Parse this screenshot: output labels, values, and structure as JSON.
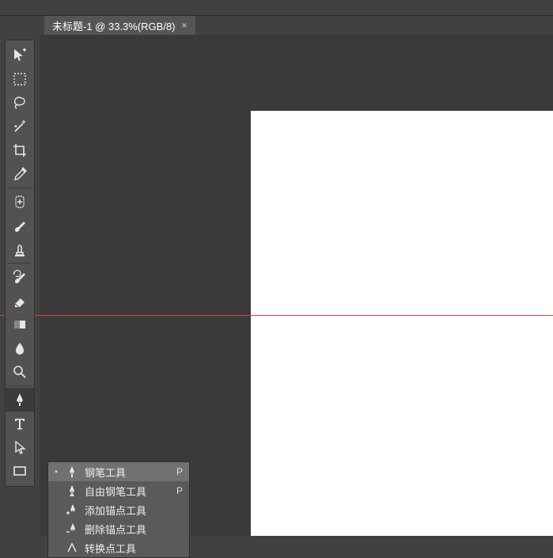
{
  "tab": {
    "title": "未标题-1 @ 33.3%(RGB/8)",
    "close": "×"
  },
  "tools": [
    {
      "id": "move-tool"
    },
    {
      "id": "marquee-tool"
    },
    {
      "id": "lasso-tool"
    },
    {
      "id": "magic-wand-tool"
    },
    {
      "id": "crop-tool"
    },
    {
      "id": "eyedropper-tool"
    },
    {
      "id": "healing-brush-tool"
    },
    {
      "id": "brush-tool"
    },
    {
      "id": "clone-stamp-tool"
    },
    {
      "id": "history-brush-tool"
    },
    {
      "id": "eraser-tool"
    },
    {
      "id": "gradient-tool"
    },
    {
      "id": "blur-tool"
    },
    {
      "id": "dodge-tool"
    },
    {
      "id": "pen-tool",
      "selected": true
    },
    {
      "id": "type-tool"
    },
    {
      "id": "path-selection-tool"
    },
    {
      "id": "rectangle-tool"
    }
  ],
  "context_menu": [
    {
      "label": "钢笔工具",
      "shortcut": "P",
      "active": true,
      "icon": "pen"
    },
    {
      "label": "自由钢笔工具",
      "shortcut": "P",
      "active": false,
      "icon": "freeform-pen"
    },
    {
      "label": "添加锚点工具",
      "shortcut": "",
      "active": false,
      "icon": "add-anchor"
    },
    {
      "label": "删除锚点工具",
      "shortcut": "",
      "active": false,
      "icon": "delete-anchor"
    },
    {
      "label": "转换点工具",
      "shortcut": "",
      "active": false,
      "icon": "convert-point"
    }
  ]
}
